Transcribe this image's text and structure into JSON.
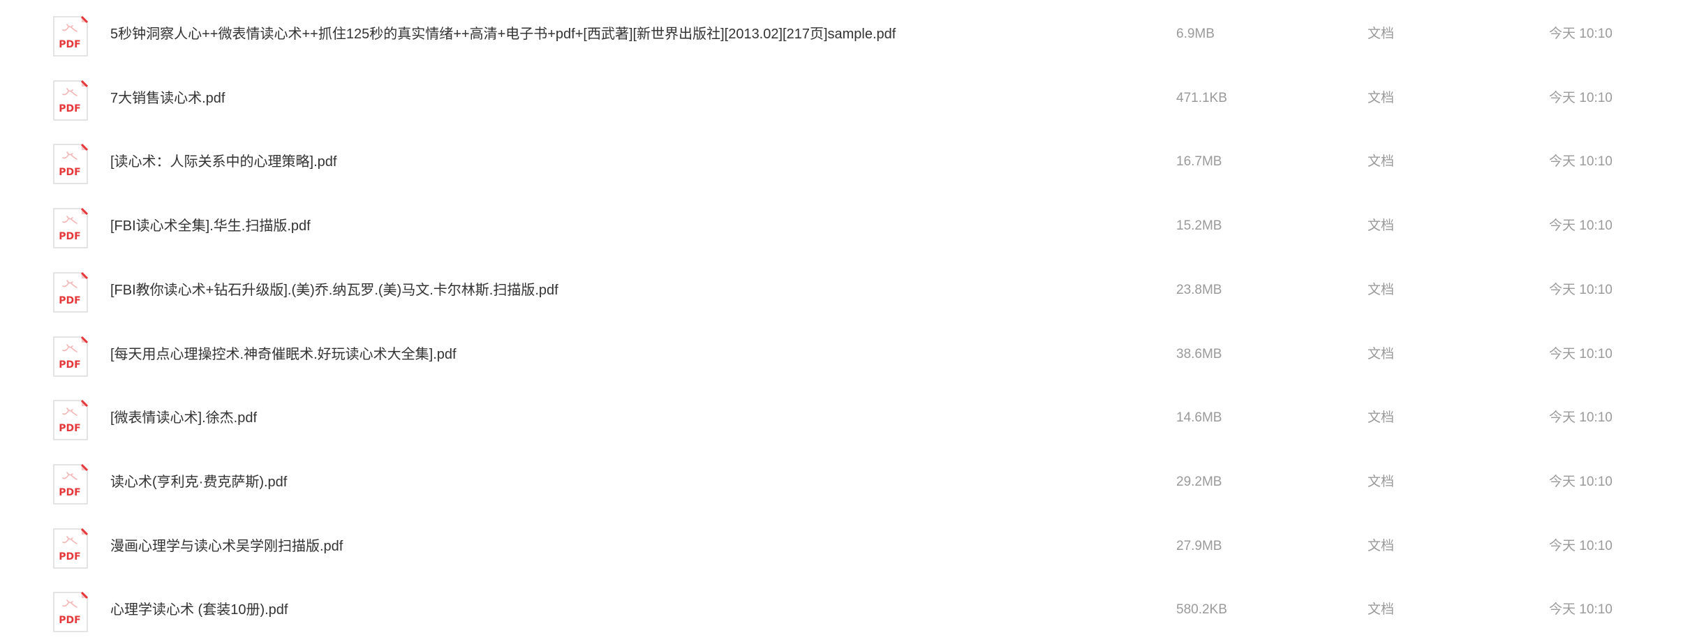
{
  "files": [
    {
      "name": "5秒钟洞察人心++微表情读心术++抓住125秒的真实情绪++高清+电子书+pdf+[西武著][新世界出版社][2013.02][217页]sample.pdf",
      "size": "6.9MB",
      "type": "文档",
      "modified": "今天 10:10",
      "icon": "pdf-icon",
      "icon_label": "PDF"
    },
    {
      "name": "7大销售读心术.pdf",
      "size": "471.1KB",
      "type": "文档",
      "modified": "今天 10:10",
      "icon": "pdf-icon",
      "icon_label": "PDF"
    },
    {
      "name": "[读心术：人际关系中的心理策略].pdf",
      "size": "16.7MB",
      "type": "文档",
      "modified": "今天 10:10",
      "icon": "pdf-icon",
      "icon_label": "PDF"
    },
    {
      "name": "[FBI读心术全集].华生.扫描版.pdf",
      "size": "15.2MB",
      "type": "文档",
      "modified": "今天 10:10",
      "icon": "pdf-icon",
      "icon_label": "PDF"
    },
    {
      "name": "[FBI教你读心术+钻石升级版].(美)乔.纳瓦罗.(美)马文.卡尔林斯.扫描版.pdf",
      "size": "23.8MB",
      "type": "文档",
      "modified": "今天 10:10",
      "icon": "pdf-icon",
      "icon_label": "PDF"
    },
    {
      "name": "[每天用点心理操控术.神奇催眠术.好玩读心术大全集].pdf",
      "size": "38.6MB",
      "type": "文档",
      "modified": "今天 10:10",
      "icon": "pdf-icon",
      "icon_label": "PDF"
    },
    {
      "name": "[微表情读心术].徐杰.pdf",
      "size": "14.6MB",
      "type": "文档",
      "modified": "今天 10:10",
      "icon": "pdf-icon",
      "icon_label": "PDF"
    },
    {
      "name": "读心术(亨利克·费克萨斯).pdf",
      "size": "29.2MB",
      "type": "文档",
      "modified": "今天 10:10",
      "icon": "pdf-icon",
      "icon_label": "PDF"
    },
    {
      "name": "漫画心理学与读心术吴学刚扫描版.pdf",
      "size": "27.9MB",
      "type": "文档",
      "modified": "今天 10:10",
      "icon": "pdf-icon",
      "icon_label": "PDF"
    },
    {
      "name": "心理学读心术 (套装10册).pdf",
      "size": "580.2KB",
      "type": "文档",
      "modified": "今天 10:10",
      "icon": "pdf-icon",
      "icon_label": "PDF"
    }
  ],
  "colors": {
    "pdf_accent": "#e5383b",
    "pdf_fold": "#f4c7c7",
    "text_primary": "#333333",
    "text_secondary": "#9a9a9a"
  }
}
